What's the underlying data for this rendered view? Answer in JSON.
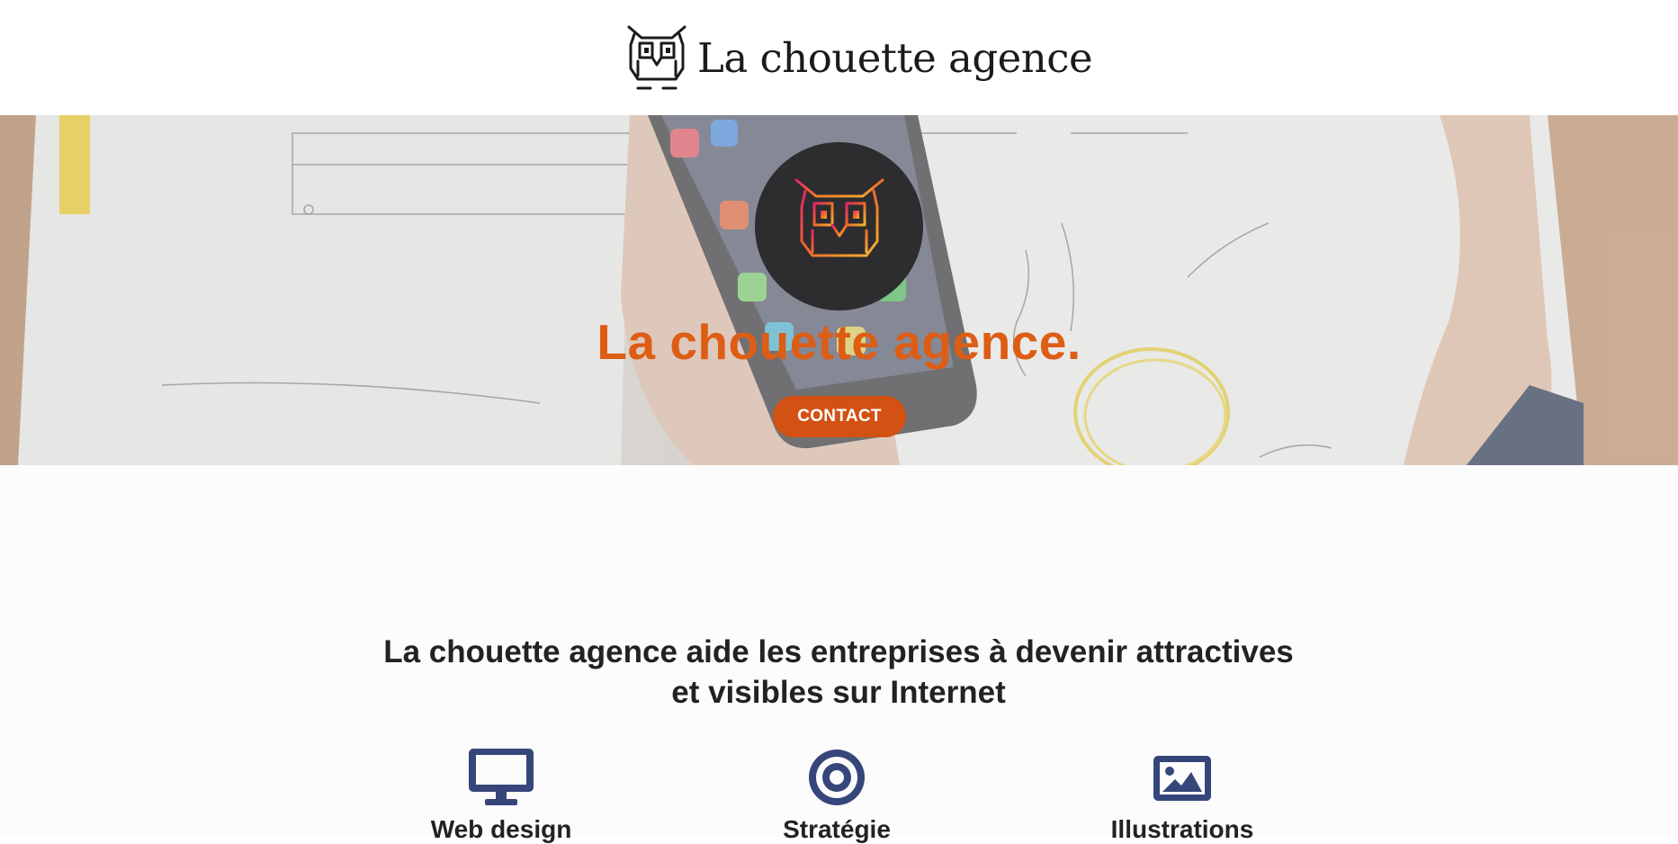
{
  "header": {
    "logo_text": "La chouette agence",
    "logo_icon": "owl-logo-icon"
  },
  "hero": {
    "badge_icon": "owl-gradient-icon",
    "title": "La chouette agence.",
    "contact_label": "CONTACT"
  },
  "intro": {
    "heading_line1": "La chouette agence aide les entreprises à devenir attractives",
    "heading_line2": "et visibles sur Internet"
  },
  "services": [
    {
      "label": "Web design",
      "icon": "desktop-icon"
    },
    {
      "label": "Stratégie",
      "icon": "target-icon"
    },
    {
      "label": "Illustrations",
      "icon": "image-icon"
    }
  ],
  "colors": {
    "accent": "#dd5d15",
    "button": "#d35112",
    "icon_blue": "#36467a",
    "badge_bg": "#2d2c2e",
    "text_dark": "#222222"
  }
}
